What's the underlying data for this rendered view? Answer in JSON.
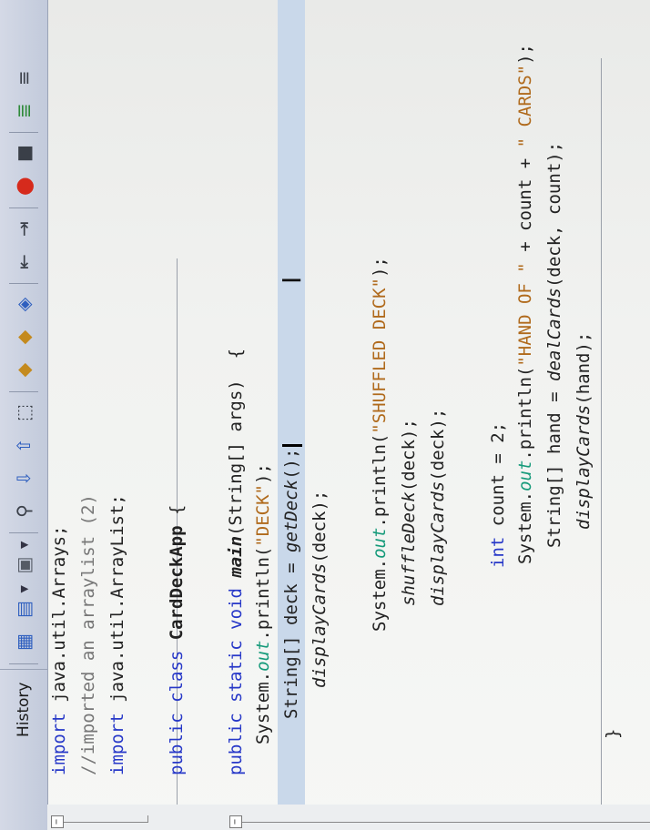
{
  "toolbar": {
    "history_tab": "History",
    "buttons": [
      {
        "icon": "source-view-icon"
      },
      {
        "icon": "open-file-icon"
      },
      {
        "icon": "navigate-icon"
      },
      {
        "icon": "search-icon"
      },
      {
        "icon": "jump-down-icon"
      },
      {
        "icon": "jump-up-icon"
      },
      {
        "icon": "toggle-selection-icon"
      },
      {
        "icon": "prev-bookmark-icon"
      },
      {
        "icon": "next-bookmark-icon"
      },
      {
        "icon": "toggle-bookmark-icon"
      },
      {
        "icon": "shift-left-icon"
      },
      {
        "icon": "shift-right-icon"
      },
      {
        "icon": "record-macro-icon"
      },
      {
        "icon": "stop-macro-icon"
      },
      {
        "icon": "comment-icon"
      },
      {
        "icon": "uncomment-icon"
      }
    ]
  },
  "code": {
    "l1": {
      "kw": "import",
      "rest": " java.util.Arrays;"
    },
    "l2": {
      "text": "//imported an arraylist (2)"
    },
    "l3": {
      "kw": "import",
      "rest": " java.util.ArrayList;"
    },
    "l4": {
      "kw": "public class",
      "name": " CardDeckApp",
      "rest": " {"
    },
    "l5": {
      "kw": "public static void",
      "name": " main",
      "rest": "(String[] args)  {"
    },
    "l6": {
      "a": "System.",
      "f": "out",
      "b": ".println(",
      "s": "\"DECK\"",
      "c": ");"
    },
    "l7": {
      "a": "String[] deck = ",
      "m": "getDeck",
      "b": "();"
    },
    "l8": {
      "m": "displayCards",
      "b": "(deck);"
    },
    "l9": {
      "a": "System.",
      "f": "out",
      "b": ".println(",
      "s": "\"SHUFFLED DECK\"",
      "c": ");"
    },
    "l10": {
      "m": "shuffleDeck",
      "b": "(deck);"
    },
    "l11": {
      "m": "displayCards",
      "b": "(deck);"
    },
    "l12": {
      "kw": "int",
      "rest": " count = 2;"
    },
    "l13": {
      "a": "System.",
      "f": "out",
      "b": ".println(",
      "s1": "\"HAND OF \"",
      "c": " + count + ",
      "s2": "\" CARDS\"",
      "d": ");"
    },
    "l14": {
      "a": "String[] hand = ",
      "m": "dealCards",
      "b": "(deck, count);"
    },
    "l15": {
      "m": "displayCards",
      "b": "(hand);"
    },
    "l16": {
      "text": "}"
    }
  },
  "colors": {
    "keyword": "#2738c8",
    "string": "#b06a1c",
    "field": "#159a7a",
    "current_line": "#c9d8ea"
  }
}
